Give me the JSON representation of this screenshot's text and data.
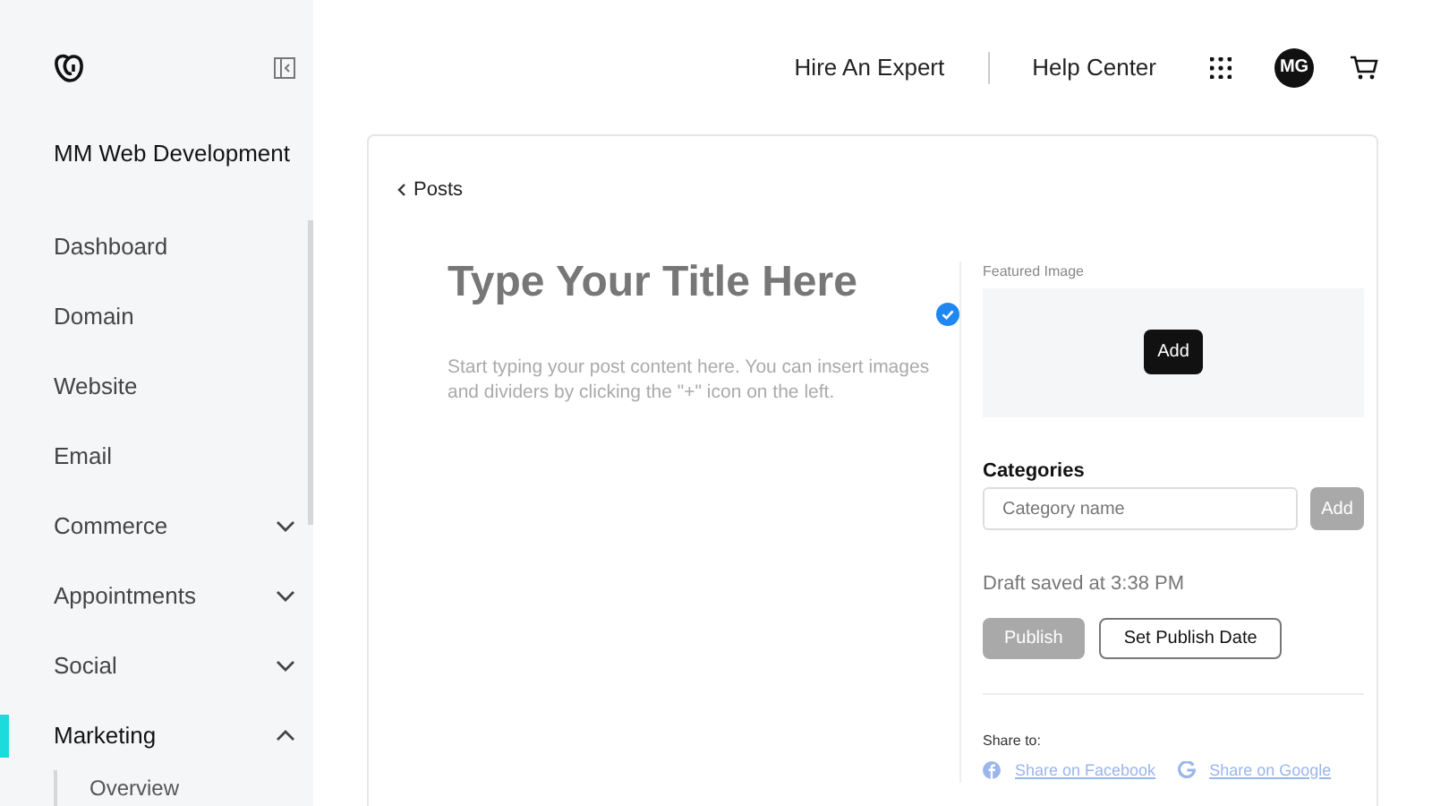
{
  "sidebar": {
    "site_name": "MM Web Development",
    "items": [
      {
        "label": "Dashboard",
        "kind": "link",
        "selected": false
      },
      {
        "label": "Domain",
        "kind": "link",
        "selected": false
      },
      {
        "label": "Website",
        "kind": "link",
        "selected": false
      },
      {
        "label": "Email",
        "kind": "link",
        "selected": false
      },
      {
        "label": "Commerce",
        "kind": "group",
        "selected": false,
        "expanded": false
      },
      {
        "label": "Appointments",
        "kind": "group",
        "selected": false,
        "expanded": false
      },
      {
        "label": "Social",
        "kind": "group",
        "selected": false,
        "expanded": false
      },
      {
        "label": "Marketing",
        "kind": "group",
        "selected": true,
        "expanded": true,
        "children": [
          {
            "label": "Overview",
            "selected": false
          }
        ]
      }
    ]
  },
  "header": {
    "links": [
      "Hire An Expert",
      "Help Center"
    ],
    "avatar": "MG"
  },
  "editor": {
    "back_link": "Posts",
    "title": {
      "placeholder": "Type Your Title Here"
    },
    "body": {
      "placeholder": "Start typing your post content here. You can insert images and dividers by clicking the \"+\" icon on the left."
    },
    "saved": true
  },
  "settings": {
    "featured_image": {
      "label": "Featured Image",
      "button": "Add"
    },
    "categories": {
      "heading": "Categories",
      "placeholder": "Category name",
      "button": "Add",
      "button_disabled": true
    },
    "draft_status": "Draft saved at 3:38 PM",
    "publish": {
      "label": "Publish",
      "disabled": true
    },
    "schedule": {
      "label": "Set Publish Date"
    },
    "share": {
      "heading": "Share to:",
      "links": [
        {
          "kind": "facebook",
          "label": "Share on Facebook"
        },
        {
          "kind": "google",
          "label": "Share on Google"
        }
      ]
    }
  }
}
